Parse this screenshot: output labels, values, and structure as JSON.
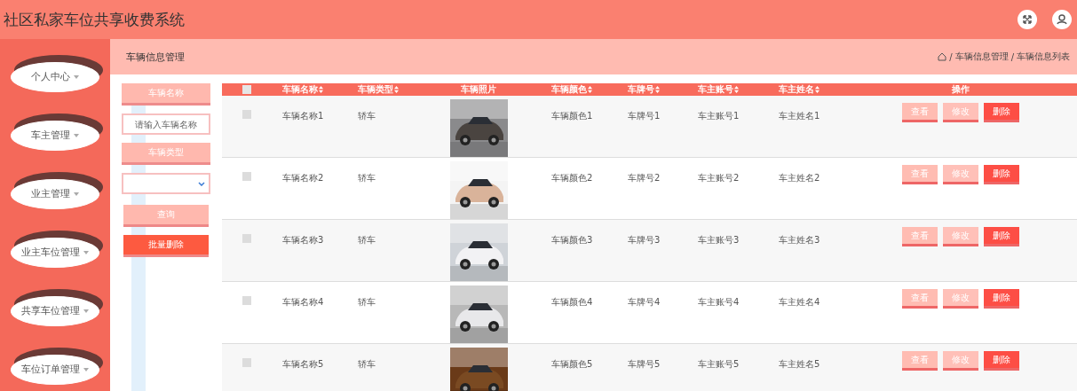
{
  "header": {
    "title": "社区私家车位共享收费系统"
  },
  "sidebar": {
    "items": [
      {
        "label": "个人中心"
      },
      {
        "label": "车主管理"
      },
      {
        "label": "业主管理"
      },
      {
        "label": "业主车位管理"
      },
      {
        "label": "共享车位管理"
      },
      {
        "label": "车位订单管理"
      }
    ]
  },
  "page_title": "车辆信息管理",
  "breadcrumb": [
    {
      "separator": "/",
      "label": "车辆信息管理"
    },
    {
      "separator": "/",
      "label": "车辆信息列表"
    }
  ],
  "filters": {
    "name_label": "车辆名称",
    "name_placeholder": "请输入车辆名称",
    "type_label": "车辆类型",
    "search_button": "查询",
    "batch_delete_button": "批量删除"
  },
  "table": {
    "select_all_checked": false,
    "columns": [
      {
        "label": "车辆名称",
        "sortable": true
      },
      {
        "label": "车辆类型",
        "sortable": true
      },
      {
        "label": "车辆照片",
        "sortable": false
      },
      {
        "label": "车辆颜色",
        "sortable": true
      },
      {
        "label": "车牌号",
        "sortable": true
      },
      {
        "label": "车主账号",
        "sortable": true
      },
      {
        "label": "车主姓名",
        "sortable": true
      },
      {
        "label": "操作",
        "sortable": false
      }
    ],
    "rows": [
      {
        "checked": false,
        "name": "车辆名称1",
        "type": "轿车",
        "vehicle_color": "车辆颜色1",
        "plate": "车牌号1",
        "account": "车主账号1",
        "owner": "车主姓名1",
        "actions": [
          "查看",
          "修改",
          "删除"
        ]
      },
      {
        "checked": false,
        "name": "车辆名称2",
        "type": "轿车",
        "vehicle_color": "车辆颜色2",
        "plate": "车牌号2",
        "account": "车主账号2",
        "owner": "车主姓名2",
        "actions": [
          "查看",
          "修改",
          "删除"
        ]
      },
      {
        "checked": false,
        "name": "车辆名称3",
        "type": "轿车",
        "vehicle_color": "车辆颜色3",
        "plate": "车牌号3",
        "account": "车主账号3",
        "owner": "车主姓名3",
        "actions": [
          "查看",
          "修改",
          "删除"
        ]
      },
      {
        "checked": false,
        "name": "车辆名称4",
        "type": "轿车",
        "vehicle_color": "车辆颜色4",
        "plate": "车牌号4",
        "account": "车主账号4",
        "owner": "车主姓名4",
        "actions": [
          "查看",
          "修改",
          "删除"
        ]
      },
      {
        "checked": false,
        "name": "车辆名称5",
        "type": "轿车",
        "vehicle_color": "车辆颜色5",
        "plate": "车牌号5",
        "account": "车主账号5",
        "owner": "车主姓名5",
        "actions": [
          "查看",
          "修改",
          "删除"
        ]
      }
    ]
  }
}
